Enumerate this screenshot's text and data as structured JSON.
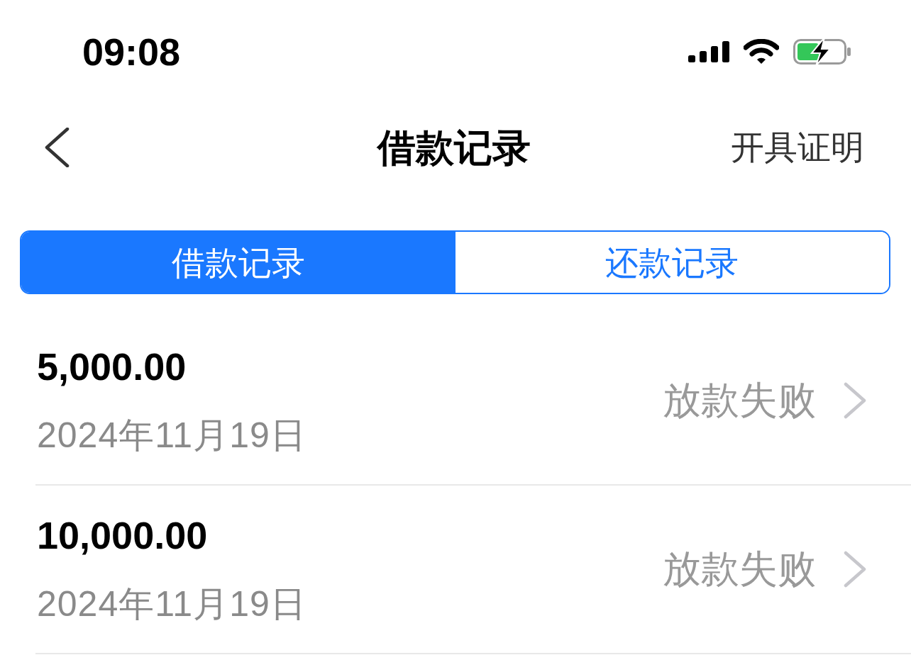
{
  "status_bar": {
    "time": "09:08"
  },
  "nav": {
    "title": "借款记录",
    "action": "开具证明"
  },
  "tabs": [
    {
      "label": "借款记录",
      "selected": true
    },
    {
      "label": "还款记录",
      "selected": false
    }
  ],
  "records": [
    {
      "amount": "5,000.00",
      "date": "2024年11月19日",
      "status": "放款失败"
    },
    {
      "amount": "10,000.00",
      "date": "2024年11月19日",
      "status": "放款失败"
    }
  ]
}
